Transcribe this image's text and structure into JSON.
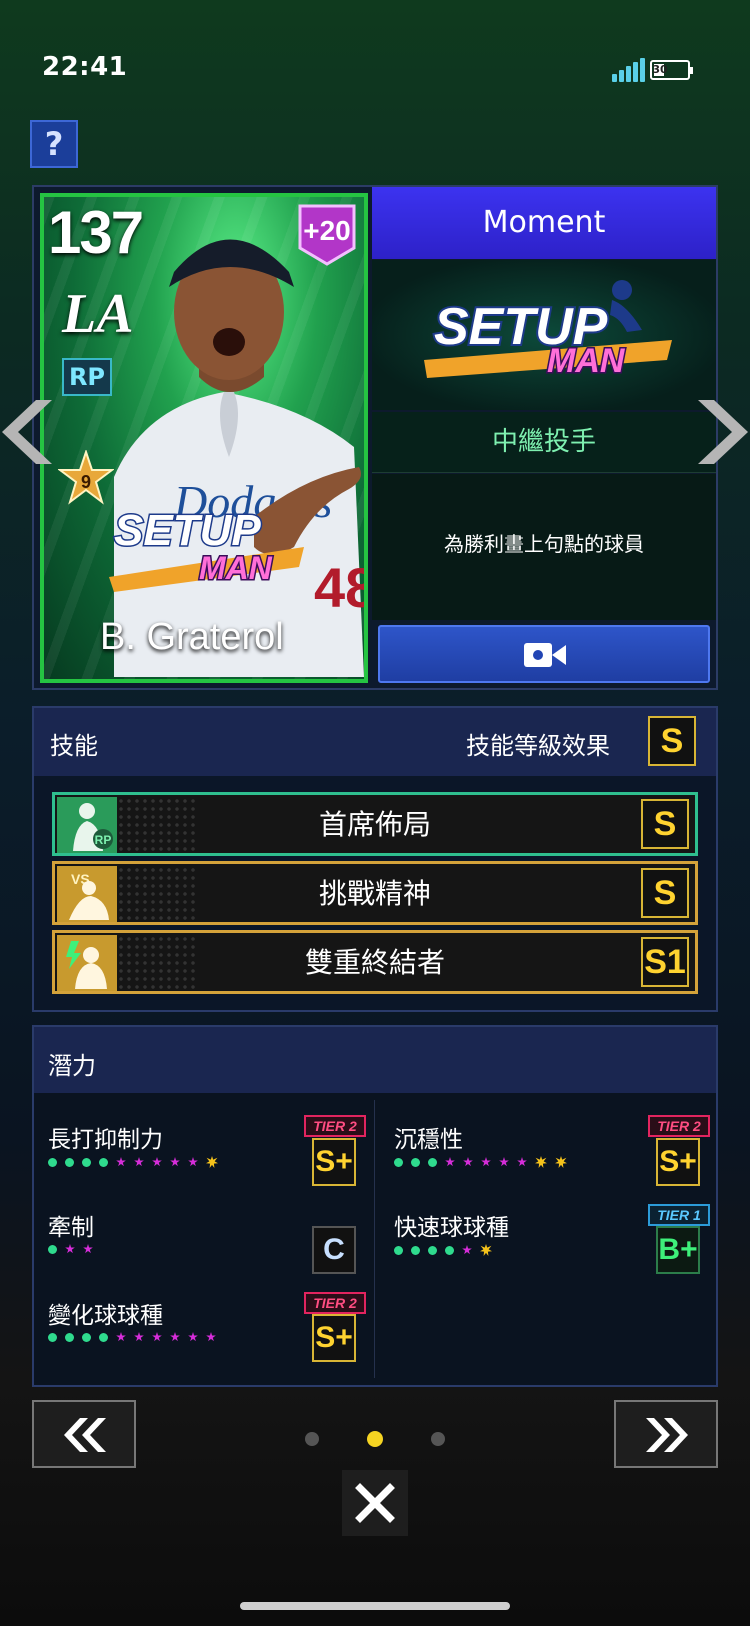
{
  "status_bar": {
    "time": "22:41",
    "battery": "30"
  },
  "help_button": {
    "label": "?"
  },
  "card": {
    "overall": "137",
    "team": "LA",
    "position": "RP",
    "boost": "+20",
    "rank_level": "9",
    "player_name": "B. Graterol",
    "card_logo_top": "SETUP",
    "card_logo_bottom": "MAN",
    "jersey_number": "48",
    "jersey_text": "Dodgers"
  },
  "moment": {
    "header": "Moment",
    "logo_top": "SETUP",
    "logo_bottom": "MAN",
    "subtitle": "中繼投手",
    "description": "為勝利畫上句點的球員"
  },
  "skills": {
    "title": "技能",
    "level_label": "技能等級效果",
    "level_grade": "S",
    "items": [
      {
        "name": "首席佈局",
        "grade": "S",
        "icon_badge": "RP"
      },
      {
        "name": "挑戰精神",
        "grade": "S",
        "icon_badge": "VS"
      },
      {
        "name": "雙重終結者",
        "grade": "S1",
        "icon_badge": ""
      }
    ]
  },
  "potential": {
    "title": "潛力",
    "items": [
      {
        "name": "長打抑制力",
        "tier": "TIER 2",
        "grade": "S+"
      },
      {
        "name": "沉穩性",
        "tier": "TIER 2",
        "grade": "S+"
      },
      {
        "name": "牽制",
        "tier": "",
        "grade": "C"
      },
      {
        "name": "快速球球種",
        "tier": "TIER 1",
        "grade": "B+"
      },
      {
        "name": "變化球球種",
        "tier": "TIER 2",
        "grade": "S+"
      }
    ]
  },
  "pagination": {
    "active_page": 2,
    "total_pages": 3
  },
  "icons": [
    "help-icon",
    "signal-icon",
    "battery-icon",
    "video-camera-icon",
    "chevron-left-icon",
    "chevron-right-icon",
    "double-chevron-left-icon",
    "double-chevron-right-icon",
    "close-icon"
  ]
}
